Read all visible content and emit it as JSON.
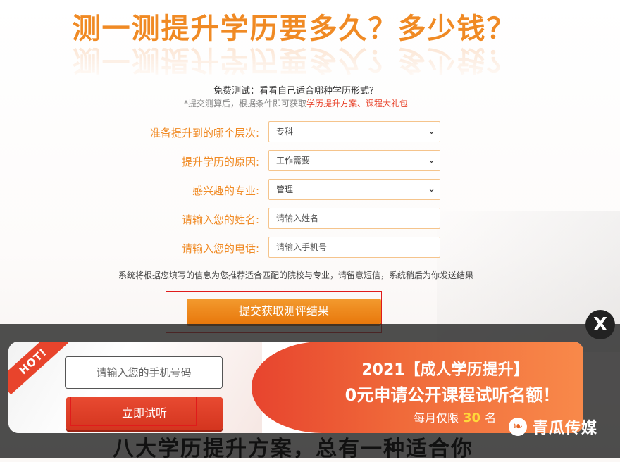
{
  "headline": "测一测提升学历要多久？多少钱？",
  "intro": {
    "line1": "免费测试：看看自己适合哪种学历形式？",
    "line2_prefix": "*提交测算后，根据条件即可获取",
    "line2_highlight": "学历提升方案、课程大礼包"
  },
  "form": {
    "level": {
      "label": "准备提升到的哪个层次:",
      "value": "专科"
    },
    "reason": {
      "label": "提升学历的原因:",
      "value": "工作需要"
    },
    "major": {
      "label": "感兴趣的专业:",
      "value": "管理"
    },
    "name": {
      "label": "请输入您的姓名:",
      "placeholder": "请输入姓名"
    },
    "phone": {
      "label": "请输入您的电话:",
      "placeholder": "请输入手机号"
    },
    "note": "系统将根据您填写的信息为您推荐适合匹配的院校与专业，请留意短信，系统稍后为你发送结果",
    "submit_label": "提交获取测评结果"
  },
  "behind_text": "八大学历提升方案，总有一种适合你",
  "popup": {
    "close_label": "X",
    "hot_label": "HOT!",
    "phone_placeholder": "请输入您的手机号码",
    "listen_label": "立即试听",
    "promo_line1": "2021【成人学历提升】",
    "promo_line2": "0元申请公开课程试听名额！",
    "promo_line3_prefix": "每月仅限",
    "promo_line3_num": "30",
    "promo_line3_suffix": "名"
  },
  "watermark": {
    "text": "青瓜传媒",
    "icon": "melon-logo-icon"
  },
  "colors": {
    "accent": "#f08a24",
    "highlight": "#e8442c",
    "outline": "#e01b1b"
  }
}
